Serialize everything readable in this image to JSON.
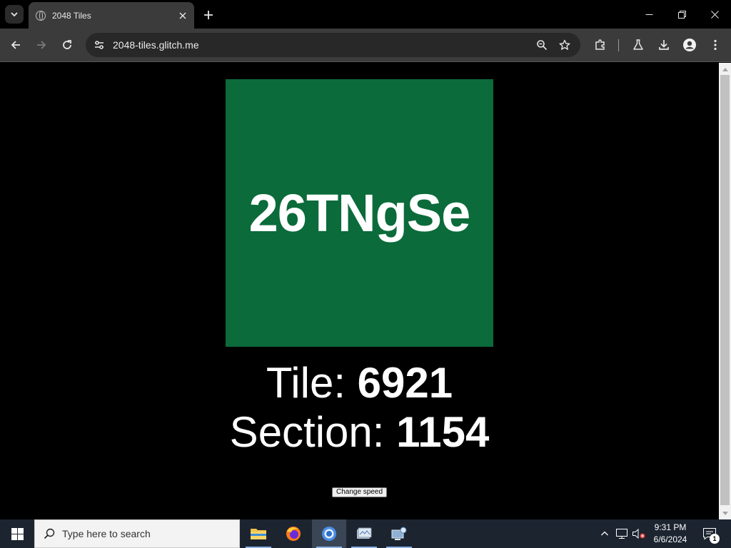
{
  "browser": {
    "tab_title": "2048 Tiles",
    "url": "2048-tiles.glitch.me"
  },
  "page": {
    "tile_code": "26TNgSe",
    "tile_color": "#0b6b3a",
    "tile_label": "Tile: ",
    "tile_number": "6921",
    "section_label": "Section: ",
    "section_number": "1154",
    "speed_button_label": "Change speed"
  },
  "taskbar": {
    "search_placeholder": "Type here to search",
    "apps": [
      "file-explorer-icon",
      "firefox-icon",
      "chrome-icon",
      "remote-desktop-icon",
      "network-app-icon"
    ],
    "time": "9:31 PM",
    "date": "6/6/2024",
    "notification_count": "1"
  }
}
